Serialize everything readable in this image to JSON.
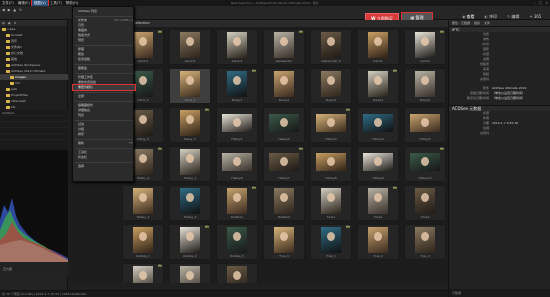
{
  "window": {
    "title": "New Selection - ACDSee Photo Studio Ultimate 2019 - 照片"
  },
  "menu": [
    {
      "label": "文件(F)",
      "active": false
    },
    {
      "label": "编辑(E)",
      "active": false
    },
    {
      "label": "视图(V)",
      "active": true
    },
    {
      "label": "工具(T)",
      "active": false
    },
    {
      "label": "帮助(H)",
      "active": false
    }
  ],
  "toolbar": {
    "upgrade_label": "立即购买",
    "mode_label": "管理",
    "mode_caption": "快速搜索",
    "views": [
      {
        "icon": "eye-icon",
        "label": "查看"
      },
      {
        "icon": "sliders-icon",
        "label": "冲印"
      },
      {
        "icon": "brush-icon",
        "label": "编辑"
      },
      {
        "icon": "sparkle-icon",
        "label": "365"
      }
    ]
  },
  "left_panel": {
    "tree": [
      {
        "label": "v-bee",
        "indent": 0
      },
      {
        "label": "Acrobat",
        "indent": 1
      },
      {
        "label": "音乐",
        "indent": 1
      },
      {
        "label": "文件夹1",
        "indent": 1
      },
      {
        "label": "办公文档",
        "indent": 1
      },
      {
        "label": "其他",
        "indent": 1
      },
      {
        "label": "ACDSee Workspace",
        "indent": 1
      },
      {
        "label": "ACDSee 2019 Ultimate",
        "indent": 1
      },
      {
        "label": "Images",
        "indent": 2,
        "selected": true
      },
      {
        "label": "Vid",
        "indent": 2
      },
      {
        "label": "web",
        "indent": 1
      },
      {
        "label": "ProjectFiles",
        "indent": 1
      },
      {
        "label": "other-test",
        "indent": 1
      },
      {
        "label": "Lib",
        "indent": 1
      },
      {
        "label": "Media",
        "indent": 1
      },
      {
        "label": "Data",
        "indent": 1
      }
    ],
    "info_title": "属性",
    "info_rows": [
      "Untitled",
      "",
      "",
      "",
      ""
    ],
    "histogram_title": "直方图"
  },
  "dropdown": {
    "items": [
      {
        "label": "ACDSee 列表",
        "shortcut": ""
      },
      {
        "label": "",
        "shortcut": ""
      },
      {
        "label": "文件夹",
        "shortcut": "Ctrl+Shift+1"
      },
      {
        "label": "日历",
        "shortcut": ""
      },
      {
        "label": "收藏夹",
        "shortcut": ""
      },
      {
        "label": "快捷方式",
        "shortcut": ""
      },
      {
        "label": "预览",
        "shortcut": ""
      },
      {
        "label": "",
        "shortcut": ""
      },
      {
        "label": "整理",
        "shortcut": ""
      },
      {
        "label": "属性",
        "shortcut": ""
      },
      {
        "label": "任务窗格",
        "shortcut": ""
      },
      {
        "label": "",
        "shortcut": ""
      },
      {
        "label": "图像篮",
        "shortcut": ""
      },
      {
        "label": "",
        "shortcut": ""
      },
      {
        "label": "管理工作区",
        "shortcut": ""
      },
      {
        "label": "重新布置窗格",
        "shortcut": ""
      },
      {
        "label": "重置为默认",
        "shortcut": "",
        "highlight": true
      },
      {
        "label": "",
        "shortcut": ""
      },
      {
        "label": "全屏",
        "shortcut": ""
      },
      {
        "label": "",
        "shortcut": ""
      },
      {
        "label": "缩略图模式",
        "shortcut": ""
      },
      {
        "label": "详细信息",
        "shortcut": ""
      },
      {
        "label": "列表",
        "shortcut": ""
      },
      {
        "label": "",
        "shortcut": ""
      },
      {
        "label": "过滤",
        "shortcut": ""
      },
      {
        "label": "分组",
        "shortcut": ""
      },
      {
        "label": "排序",
        "shortcut": ""
      },
      {
        "label": "",
        "shortcut": ""
      },
      {
        "label": "刷新",
        "shortcut": "F5"
      },
      {
        "label": "",
        "shortcut": ""
      },
      {
        "label": "工具栏",
        "shortcut": ""
      },
      {
        "label": "状态栏",
        "shortcut": ""
      },
      {
        "label": "",
        "shortcut": ""
      },
      {
        "label": "选择",
        "shortcut": ""
      }
    ]
  },
  "gallery": {
    "header": "New Selection",
    "rows": [
      [
        "Aaron1",
        "Aaron2",
        "Aaron3",
        "aleksander",
        "aleksander_0",
        "Carol1",
        "Carol2"
      ],
      [
        "Carol_0",
        "Carol_1",
        "Daisy1",
        "Daisy2",
        "Daisy3",
        "Daisy4",
        "Daisy5"
      ],
      [
        "Daisy_0",
        "Daisy_1",
        "Hailey1",
        "Hailey2",
        "Hailey3",
        "Hailey4",
        "Hailey5"
      ],
      [
        "Hailey_0",
        "Hailey_1",
        "Hailey6",
        "Hailey7",
        "Hailey8",
        "Hailey9",
        "Hailey10"
      ],
      [
        "Hailey_2",
        "Hailey_3",
        "Robbie1",
        "Robbie2",
        "Tina1",
        "Tina2",
        "Tina3"
      ],
      [
        "Robbie_1",
        "Robbie_2",
        "Robbie_3",
        "Tina_0",
        "Tina_1",
        "Tina_2",
        "Tina_3"
      ],
      [
        "Tina4",
        "Tina5",
        "Tina6"
      ]
    ],
    "status": "共 39 个项目 (0.0 KB) | 2019-1-7 15:33 | 1463x2048x24b"
  },
  "right_panel": {
    "tabs": [
      "属性 - 元数据",
      "组织",
      "文件"
    ],
    "section1": "IPTC",
    "rows1": [
      {
        "k": "位置",
        "v": ""
      },
      {
        "k": "城市",
        "v": ""
      },
      {
        "k": "州/省",
        "v": ""
      },
      {
        "k": "国家",
        "v": ""
      },
      {
        "k": "标题",
        "v": ""
      },
      {
        "k": "说明",
        "v": ""
      },
      {
        "k": "创建者",
        "v": ""
      },
      {
        "k": "来源",
        "v": ""
      },
      {
        "k": "版权",
        "v": ""
      },
      {
        "k": "关键词",
        "v": ""
      }
    ],
    "rows2": [
      {
        "k": "软件",
        "v": "ACDSee Ultimate 2019"
      },
      {
        "k": "原始日期/时间",
        "v": "（单击以设置日期时间）"
      },
      {
        "k": "数字化日期/时间",
        "v": "（单击以设置日期时间）"
      }
    ],
    "section2": "ACDSee 元数据",
    "rows3": [
      {
        "k": "标题",
        "v": ""
      },
      {
        "k": "作者",
        "v": ""
      },
      {
        "k": "日期",
        "v": "2019-1-7 9:45:26"
      },
      {
        "k": "注释",
        "v": ""
      },
      {
        "k": "关键词",
        "v": ""
      }
    ],
    "bottom_label": "元数据"
  }
}
